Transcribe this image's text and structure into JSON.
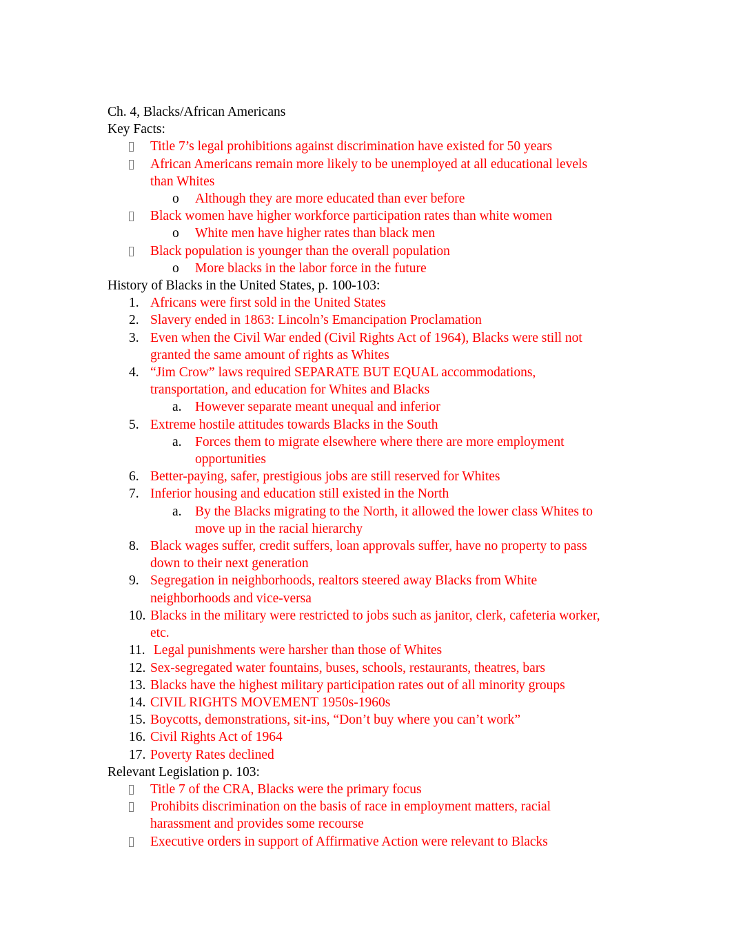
{
  "document": {
    "title": "Ch. 4, Blacks/African Americans",
    "text_color_body": "#ff0000",
    "text_color_heading": "#000000",
    "bullet_glyph": "missing-glyph-box"
  },
  "sections": [
    {
      "heading": "Key Facts:",
      "items": [
        {
          "level": 1,
          "marker": "bullet",
          "text": "Title 7’s legal prohibitions against discrimination have existed for 50 years"
        },
        {
          "level": 1,
          "marker": "bullet",
          "text": "African Americans remain more likely to be unemployed at all educational levels than Whites"
        },
        {
          "level": 2,
          "marker": "o",
          "text": "Although they are more educated than ever before"
        },
        {
          "level": 1,
          "marker": "bullet",
          "text": "Black women have higher workforce participation rates than white women"
        },
        {
          "level": 2,
          "marker": "o",
          "text": "White men have higher rates than black men"
        },
        {
          "level": 1,
          "marker": "bullet",
          "text": "Black population is younger than the overall population"
        },
        {
          "level": 2,
          "marker": "o",
          "text": "More blacks in the labor force in the future"
        }
      ]
    },
    {
      "heading": "History of Blacks in the United States, p. 100-103:",
      "items": [
        {
          "level": 1,
          "marker": "1.",
          "text": "Africans were first sold in the United States"
        },
        {
          "level": 1,
          "marker": "2.",
          "text": "Slavery ended in 1863: Lincoln’s Emancipation Proclamation"
        },
        {
          "level": 1,
          "marker": "3.",
          "text": "Even when the Civil War ended (Civil Rights Act of 1964), Blacks were still not granted the same amount of rights as Whites"
        },
        {
          "level": 1,
          "marker": "4.",
          "text": "“Jim Crow” laws required SEPARATE BUT EQUAL accommodations, transportation, and education for Whites and Blacks"
        },
        {
          "level": 2,
          "marker": "a.",
          "text": "However separate meant unequal and inferior"
        },
        {
          "level": 1,
          "marker": "5.",
          "text": "Extreme hostile attitudes towards Blacks in the South"
        },
        {
          "level": 2,
          "marker": "a.",
          "text": "Forces them to migrate elsewhere where there are more employment opportunities"
        },
        {
          "level": 1,
          "marker": "6.",
          "text": "Better-paying, safer, prestigious jobs are still reserved for Whites"
        },
        {
          "level": 1,
          "marker": "7.",
          "text": "Inferior housing and education still existed in the North"
        },
        {
          "level": 2,
          "marker": "a.",
          "text": "By the Blacks migrating to the North, it allowed the lower class Whites to move up in the racial hierarchy"
        },
        {
          "level": 1,
          "marker": "8.",
          "text": "Black wages suffer, credit suffers, loan approvals suffer, have no property to pass down to their next generation"
        },
        {
          "level": 1,
          "marker": "9.",
          "text": "Segregation in neighborhoods, realtors steered away Blacks from White neighborhoods and vice-versa"
        },
        {
          "level": 1,
          "marker": "10.",
          "text": "Blacks in the military were restricted to jobs such as janitor, clerk, cafeteria worker, etc."
        },
        {
          "level": 1,
          "marker": "11.",
          "text": " Legal punishments were harsher than those of Whites"
        },
        {
          "level": 1,
          "marker": "12.",
          "text": "Sex-segregated water fountains, buses, schools, restaurants, theatres, bars"
        },
        {
          "level": 1,
          "marker": "13.",
          "text": "Blacks have the highest military participation rates out of all minority groups"
        },
        {
          "level": 1,
          "marker": "14.",
          "text": "CIVIL RIGHTS MOVEMENT 1950s-1960s"
        },
        {
          "level": 1,
          "marker": "15.",
          "text": "Boycotts, demonstrations, sit-ins, “Don’t buy where you can’t work”"
        },
        {
          "level": 1,
          "marker": "16.",
          "text": "Civil Rights Act of 1964"
        },
        {
          "level": 1,
          "marker": "17.",
          "text": "Poverty Rates declined"
        }
      ]
    },
    {
      "heading": "Relevant Legislation p. 103:",
      "items": [
        {
          "level": 1,
          "marker": "bullet",
          "text": "Title 7 of the CRA, Blacks were the primary focus"
        },
        {
          "level": 1,
          "marker": "bullet",
          "text": "Prohibits discrimination on the basis of race in employment matters, racial harassment and provides some recourse"
        },
        {
          "level": 1,
          "marker": "bullet",
          "text": "Executive orders in support of Affirmative Action were relevant to Blacks"
        }
      ]
    }
  ]
}
